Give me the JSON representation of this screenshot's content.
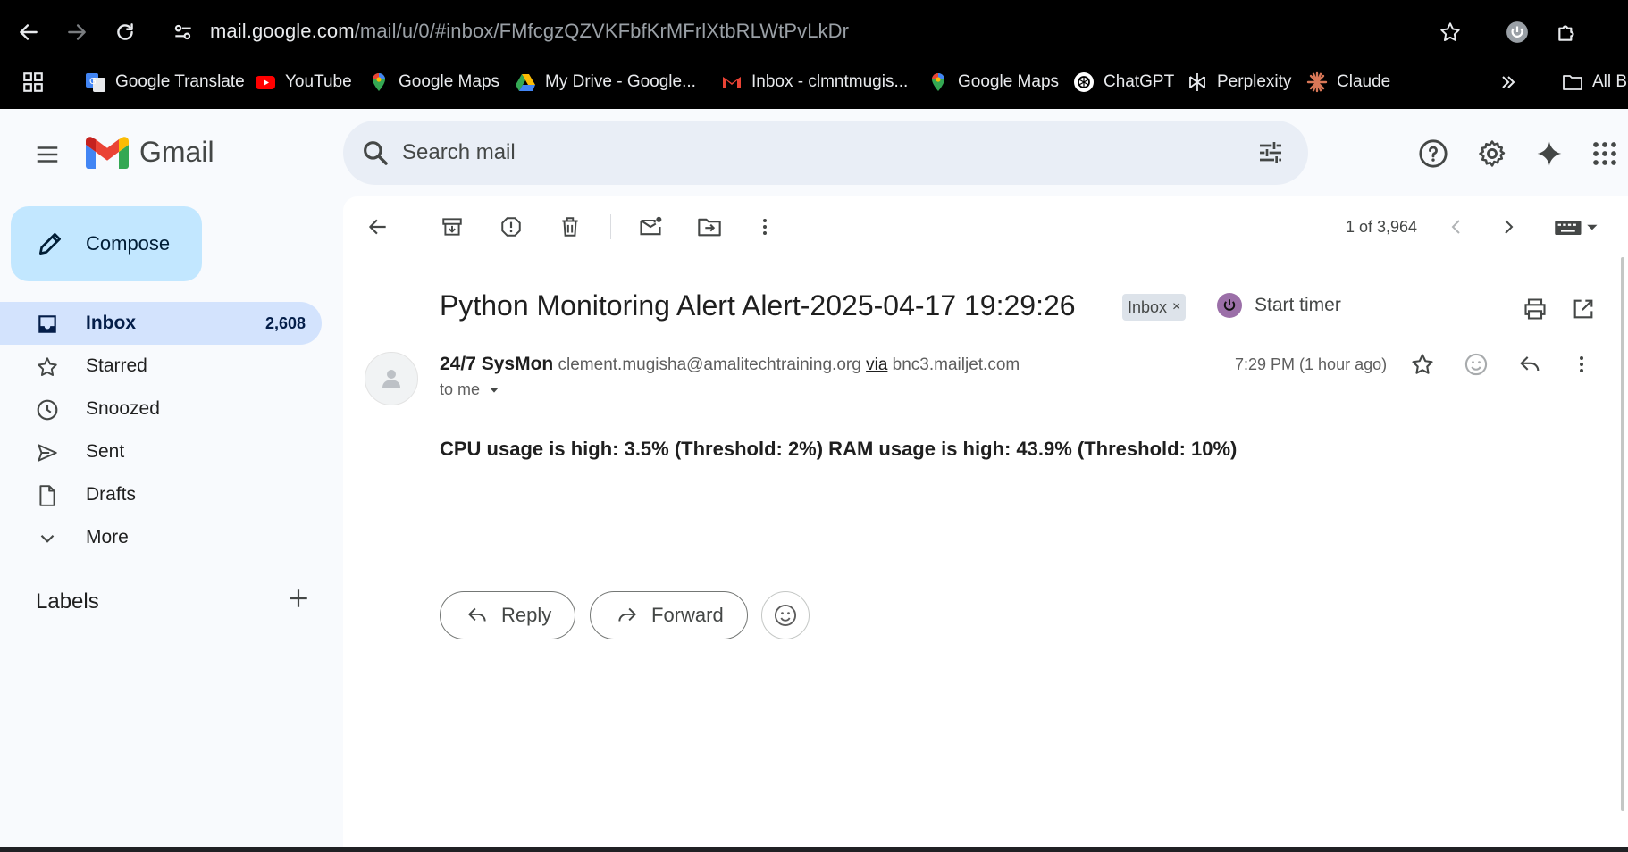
{
  "browser": {
    "url_host": "mail.google.com",
    "url_path": "/mail/u/0/#inbox/FMfcgzQZVKFbfKrMFrlXtbRLWtPvLkDr",
    "bookmarks": [
      {
        "label": "Google Translate",
        "icon": "google-translate-icon"
      },
      {
        "label": "YouTube",
        "icon": "youtube-icon"
      },
      {
        "label": "Google Maps",
        "icon": "google-maps-icon"
      },
      {
        "label": "My Drive - Google...",
        "icon": "google-drive-icon"
      },
      {
        "label": "Inbox - clmntmugis...",
        "icon": "gmail-icon"
      },
      {
        "label": "Google Maps",
        "icon": "google-maps-icon"
      },
      {
        "label": "ChatGPT",
        "icon": "chatgpt-icon"
      },
      {
        "label": "Perplexity",
        "icon": "perplexity-icon"
      },
      {
        "label": "Claude",
        "icon": "claude-icon"
      }
    ],
    "all_bookmarks_label": "All Bo"
  },
  "gmail": {
    "logo_text": "Gmail",
    "search_placeholder": "Search mail",
    "compose_label": "Compose",
    "nav": [
      {
        "label": "Inbox",
        "count": "2,608",
        "icon": "inbox-icon",
        "active": true
      },
      {
        "label": "Starred",
        "count": "",
        "icon": "star-icon"
      },
      {
        "label": "Snoozed",
        "count": "",
        "icon": "clock-icon"
      },
      {
        "label": "Sent",
        "count": "",
        "icon": "send-icon"
      },
      {
        "label": "Drafts",
        "count": "",
        "icon": "draft-icon"
      },
      {
        "label": "More",
        "count": "",
        "icon": "chevron-down-icon"
      }
    ],
    "labels_heading": "Labels"
  },
  "message": {
    "counter": "1 of 3,964",
    "subject": "Python Monitoring Alert Alert-2025-04-17 19:29:26",
    "label_chip": "Inbox",
    "timer_label": "Start timer",
    "sender_name": "24/7 SysMon",
    "sender_email": "clement.mugisha@amalitechtraining.org",
    "via_label": "via",
    "via_domain": "bnc3.mailjet.com",
    "recipient": "to me",
    "timestamp": "7:29 PM (1 hour ago)",
    "body": "CPU usage is high: 3.5% (Threshold: 2%) RAM usage is high: 43.9% (Threshold: 10%)",
    "reply_label": "Reply",
    "forward_label": "Forward"
  },
  "colors": {
    "accent": "#c2e7ff",
    "active_nav": "#d3e3fd",
    "search_bg": "#e9eef6"
  }
}
